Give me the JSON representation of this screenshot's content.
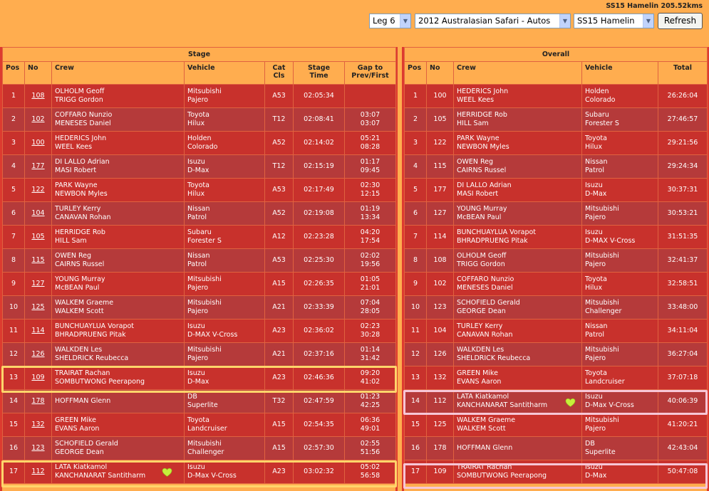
{
  "header": {
    "stage_title": "SS15 Hamelin 205.52kms",
    "leg_select": "Leg 6",
    "event_select": "2012 Australasian Safari - Autos",
    "stage_select": "SS15 Hamelin",
    "refresh_label": "Refresh"
  },
  "stage": {
    "title": "Stage",
    "columns": {
      "pos": "Pos",
      "no": "No",
      "crew": "Crew",
      "vehicle": "Vehicle",
      "cat1": "Cat",
      "cat2": "Cls",
      "time1": "Stage",
      "time2": "Time",
      "gap1": "Gap to",
      "gap2": "Prev/First"
    },
    "rows": [
      {
        "pos": "1",
        "no": "108",
        "crew1": "OLHOLM Geoff",
        "crew2": "TRIGG Gordon",
        "veh1": "Mitsubishi",
        "veh2": "Pajero",
        "cls": "A53",
        "time": "02:05:34",
        "gap1": "",
        "gap2": ""
      },
      {
        "pos": "2",
        "no": "102",
        "crew1": "COFFARO Nunzio",
        "crew2": "MENESES Daniel",
        "veh1": "Toyota",
        "veh2": "Hilux",
        "cls": "T12",
        "time": "02:08:41",
        "gap1": "03:07",
        "gap2": "03:07"
      },
      {
        "pos": "3",
        "no": "100",
        "crew1": "HEDERICS John",
        "crew2": "WEEL Kees",
        "veh1": "Holden",
        "veh2": "Colorado",
        "cls": "A52",
        "time": "02:14:02",
        "gap1": "05:21",
        "gap2": "08:28"
      },
      {
        "pos": "4",
        "no": "177",
        "crew1": "DI LALLO Adrian",
        "crew2": "MASI Robert",
        "veh1": "Isuzu",
        "veh2": "D-Max",
        "cls": "T12",
        "time": "02:15:19",
        "gap1": "01:17",
        "gap2": "09:45"
      },
      {
        "pos": "5",
        "no": "122",
        "crew1": "PARK Wayne",
        "crew2": "NEWBON Myles",
        "veh1": "Toyota",
        "veh2": "Hilux",
        "cls": "A53",
        "time": "02:17:49",
        "gap1": "02:30",
        "gap2": "12:15"
      },
      {
        "pos": "6",
        "no": "104",
        "crew1": "TURLEY Kerry",
        "crew2": "CANAVAN Rohan",
        "veh1": "Nissan",
        "veh2": "Patrol",
        "cls": "A52",
        "time": "02:19:08",
        "gap1": "01:19",
        "gap2": "13:34"
      },
      {
        "pos": "7",
        "no": "105",
        "crew1": "HERRIDGE Rob",
        "crew2": "HILL Sam",
        "veh1": "Subaru",
        "veh2": "Forester S",
        "cls": "A12",
        "time": "02:23:28",
        "gap1": "04:20",
        "gap2": "17:54"
      },
      {
        "pos": "8",
        "no": "115",
        "crew1": "OWEN Reg",
        "crew2": "CAIRNS Russel",
        "veh1": "Nissan",
        "veh2": "Patrol",
        "cls": "A53",
        "time": "02:25:30",
        "gap1": "02:02",
        "gap2": "19:56"
      },
      {
        "pos": "9",
        "no": "127",
        "crew1": "YOUNG Murray",
        "crew2": "McBEAN Paul",
        "veh1": "Mitsubishi",
        "veh2": "Pajero",
        "cls": "A15",
        "time": "02:26:35",
        "gap1": "01:05",
        "gap2": "21:01"
      },
      {
        "pos": "10",
        "no": "125",
        "crew1": "WALKEM Graeme",
        "crew2": "WALKEM Scott",
        "veh1": "Mitsubishi",
        "veh2": "Pajero",
        "cls": "A21",
        "time": "02:33:39",
        "gap1": "07:04",
        "gap2": "28:05"
      },
      {
        "pos": "11",
        "no": "114",
        "crew1": "BUNCHUAYLUA Vorapot",
        "crew2": "BHRADPRUENG Pitak",
        "veh1": "Isuzu",
        "veh2": "D-MAX V-Cross",
        "cls": "A23",
        "time": "02:36:02",
        "gap1": "02:23",
        "gap2": "30:28"
      },
      {
        "pos": "12",
        "no": "126",
        "crew1": "WALKDEN Les",
        "crew2": "SHELDRICK Reubecca",
        "veh1": "Mitsubishi",
        "veh2": "Pajero",
        "cls": "A21",
        "time": "02:37:16",
        "gap1": "01:14",
        "gap2": "31:42"
      },
      {
        "pos": "13",
        "no": "109",
        "crew1": "TRAIRAT Rachan",
        "crew2": "SOMBUTWONG Peerapong",
        "veh1": "Isuzu",
        "veh2": "D-Max",
        "cls": "A23",
        "time": "02:46:36",
        "gap1": "09:20",
        "gap2": "41:02"
      },
      {
        "pos": "14",
        "no": "178",
        "crew1": "HOFFMAN Glenn",
        "crew2": "",
        "veh1": "DB",
        "veh2": "Superlite",
        "cls": "T32",
        "time": "02:47:59",
        "gap1": "01:23",
        "gap2": "42:25"
      },
      {
        "pos": "15",
        "no": "132",
        "crew1": "GREEN Mike",
        "crew2": "EVANS Aaron",
        "veh1": "Toyota",
        "veh2": "Landcruiser",
        "cls": "A15",
        "time": "02:54:35",
        "gap1": "06:36",
        "gap2": "49:01"
      },
      {
        "pos": "16",
        "no": "123",
        "crew1": "SCHOFIELD Gerald",
        "crew2": "GEORGE Dean",
        "veh1": "Mitsubishi",
        "veh2": "Challenger",
        "cls": "A15",
        "time": "02:57:30",
        "gap1": "02:55",
        "gap2": "51:56"
      },
      {
        "pos": "17",
        "no": "112",
        "crew1": "LATA Kiatkamol",
        "crew2": "KANCHANARAT Santitharm",
        "veh1": "Isuzu",
        "veh2": "D-Max V-Cross",
        "cls": "A23",
        "time": "03:02:32",
        "gap1": "05:02",
        "gap2": "56:58"
      }
    ]
  },
  "overall": {
    "title": "Overall",
    "columns": {
      "pos": "Pos",
      "no": "No",
      "crew": "Crew",
      "vehicle": "Vehicle",
      "total": "Total"
    },
    "rows": [
      {
        "pos": "1",
        "no": "100",
        "crew1": "HEDERICS  John",
        "crew2": "WEEL Kees",
        "veh1": "Holden",
        "veh2": "Colorado",
        "total": "26:26:04"
      },
      {
        "pos": "2",
        "no": "105",
        "crew1": "HERRIDGE Rob",
        "crew2": "HILL Sam",
        "veh1": "Subaru",
        "veh2": "Forester S",
        "total": "27:46:57"
      },
      {
        "pos": "3",
        "no": "122",
        "crew1": "PARK  Wayne",
        "crew2": "NEWBON Myles",
        "veh1": "Toyota",
        "veh2": "Hilux",
        "total": "29:21:56"
      },
      {
        "pos": "4",
        "no": "115",
        "crew1": "OWEN Reg",
        "crew2": "CAIRNS Russel",
        "veh1": "Nissan",
        "veh2": "Patrol",
        "total": "29:24:34"
      },
      {
        "pos": "5",
        "no": "177",
        "crew1": "DI LALLO  Adrian",
        "crew2": "MASI Robert",
        "veh1": "Isuzu",
        "veh2": "D-Max",
        "total": "30:37:31"
      },
      {
        "pos": "6",
        "no": "127",
        "crew1": "YOUNG Murray",
        "crew2": "McBEAN Paul",
        "veh1": "Mitsubishi",
        "veh2": "Pajero",
        "total": "30:53:21"
      },
      {
        "pos": "7",
        "no": "114",
        "crew1": "BUNCHUAYLUA  Vorapot",
        "crew2": "BHRADPRUENG Pitak",
        "veh1": "Isuzu",
        "veh2": "D-MAX V-Cross",
        "total": "31:51:35"
      },
      {
        "pos": "8",
        "no": "108",
        "crew1": "OLHOLM Geoff",
        "crew2": "TRIGG Gordon",
        "veh1": "Mitsubishi",
        "veh2": "Pajero",
        "total": "32:41:37"
      },
      {
        "pos": "9",
        "no": "102",
        "crew1": "COFFARO  Nunzio",
        "crew2": "MENESES Daniel",
        "veh1": "Toyota",
        "veh2": "Hilux",
        "total": "32:58:51"
      },
      {
        "pos": "10",
        "no": "123",
        "crew1": "SCHOFIELD Gerald",
        "crew2": "GEORGE Dean",
        "veh1": "Mitsubishi",
        "veh2": "Challenger",
        "total": "33:48:00"
      },
      {
        "pos": "11",
        "no": "104",
        "crew1": "TURLEY  Kerry",
        "crew2": "CANAVAN Rohan",
        "veh1": "Nissan",
        "veh2": "Patrol",
        "total": "34:11:04"
      },
      {
        "pos": "12",
        "no": "126",
        "crew1": "WALKDEN Les",
        "crew2": "SHELDRICK Reubecca",
        "veh1": "Mitsubishi",
        "veh2": "Pajero",
        "total": "36:27:04"
      },
      {
        "pos": "13",
        "no": "132",
        "crew1": "GREEN  Mike",
        "crew2": "EVANS Aaron",
        "veh1": "Toyota",
        "veh2": "Landcruiser",
        "total": "37:07:18"
      },
      {
        "pos": "14",
        "no": "112",
        "crew1": "LATA Kiatkamol",
        "crew2": "KANCHANARAT Santitharm",
        "veh1": "Isuzu",
        "veh2": "D-Max V-Cross",
        "total": "40:06:39"
      },
      {
        "pos": "15",
        "no": "125",
        "crew1": "WALKEM  Graeme",
        "crew2": "WALKEM Scott",
        "veh1": "Mitsubishi",
        "veh2": "Pajero",
        "total": "41:20:21"
      },
      {
        "pos": "16",
        "no": "178",
        "crew1": "HOFFMAN Glenn",
        "crew2": "",
        "veh1": "DB",
        "veh2": "Superlite",
        "total": "42:43:04"
      },
      {
        "pos": "17",
        "no": "109",
        "crew1": "TRAIRAT  Rachan",
        "crew2": "SOMBUTWONG Peerapong",
        "veh1": "Isuzu",
        "veh2": "D-Max",
        "total": "50:47:08"
      }
    ]
  },
  "colors": {
    "page_bg": "#ffad4f",
    "row_odd": "#c8312c",
    "row_even": "#b53a3a",
    "highlight_yellow": "#ffd56b",
    "highlight_pink": "#f7c6d6",
    "heart": "#c6ef3b"
  },
  "icons": {
    "heart": "heart-icon",
    "dropdown": "chevron-down-icon"
  }
}
